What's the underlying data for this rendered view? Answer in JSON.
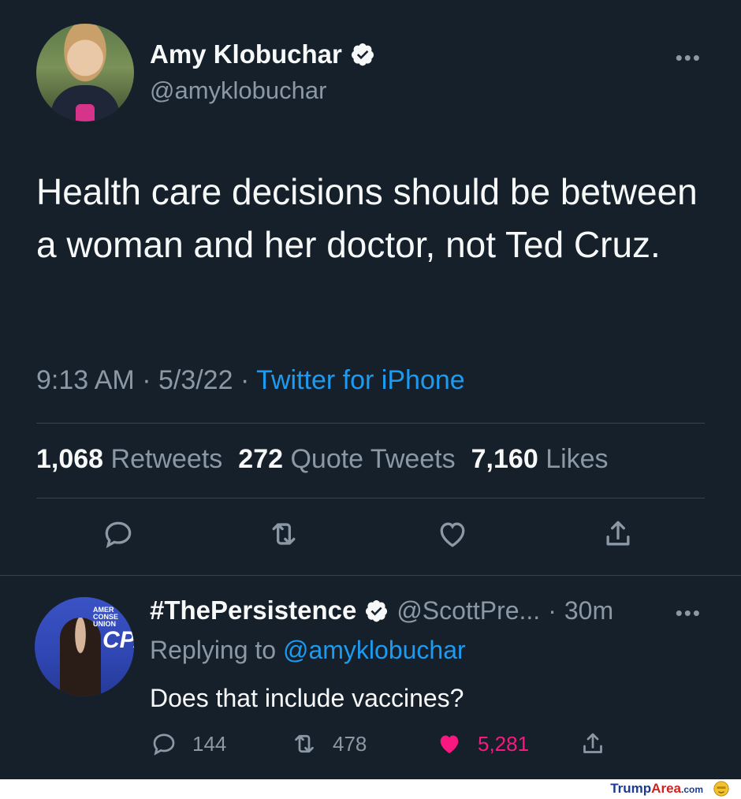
{
  "tweet": {
    "author": {
      "name": "Amy Klobuchar",
      "handle": "@amyklobuchar",
      "avatar": "profile-photo",
      "verified": true
    },
    "text": "Health care decisions should be between a woman and her doctor, not Ted Cruz.",
    "time": "9:13 AM",
    "date": "5/3/22",
    "source": "Twitter for iPhone",
    "stats": {
      "retweets_count": "1,068",
      "retweets_label": "Retweets",
      "quotes_count": "272",
      "quotes_label": "Quote Tweets",
      "likes_count": "7,160",
      "likes_label": "Likes"
    },
    "actions": [
      "reply-icon",
      "retweet-icon",
      "like-icon",
      "share-icon"
    ]
  },
  "reply": {
    "author": {
      "name": "#ThePersistence",
      "handle": "@ScottPre...",
      "verified": true
    },
    "time": "30m",
    "replying_label": "Replying to",
    "replying_to": "@amyklobuchar",
    "text": "Does that include vaccines?",
    "counts": {
      "replies": "144",
      "retweets": "478",
      "likes": "5,281"
    },
    "liked": true
  },
  "avatar_text": {
    "logo_lines": [
      "AMER",
      "CONSE",
      "UNION"
    ],
    "logo_mark": "CPAC"
  },
  "watermark": {
    "part1": "Trump",
    "part2": "Area",
    "part3": ".com"
  },
  "colors": {
    "background": "#15202b",
    "text": "#f7f9f9",
    "secondary": "#8b98a5",
    "link": "#1d9bf0",
    "like": "#f91880",
    "divider": "#38444d"
  }
}
